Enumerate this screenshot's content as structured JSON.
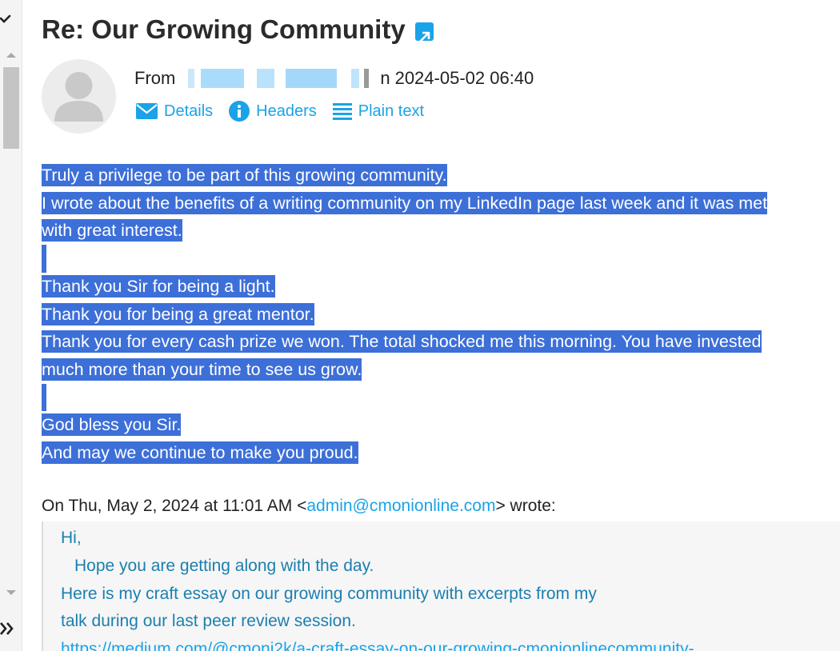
{
  "message": {
    "subject": "Re: Our Growing Community",
    "from_label": "From",
    "date_prefix": "n",
    "date": "2024-05-02 06:40",
    "actions": {
      "details": "Details",
      "headers": "Headers",
      "plain_text": "Plain text"
    },
    "body_lines": [
      "Truly a privilege to be part of this growing community.",
      "I wrote about the benefits of a writing community on my LinkedIn page last week and it was met",
      "with great interest.",
      "",
      "Thank you Sir for being a light.",
      "Thank you for being a great mentor.",
      "Thank you for every cash prize we won. The total shocked me this morning. You have invested",
      "much more than your time to see us grow.",
      "",
      "God bless you Sir.",
      "And may we continue to make you proud."
    ],
    "quote_intro": {
      "prefix": "On Thu, May 2, 2024 at 11:01 AM <",
      "email": "admin@cmonionline.com",
      "suffix": "> wrote:"
    },
    "quote_lines": {
      "greeting": "Hi,",
      "line1": "Hope you are getting along with the day.",
      "line2": "Here is my craft essay on our growing community with excerpts from my",
      "line3": "talk during our last peer review session.",
      "link": "https://medium.com/@cmoni2k/a-craft-essay-on-our-growing-cmonionlinecommunity-"
    }
  },
  "icons": {
    "external_link": "external-link-icon",
    "envelope": "envelope-icon",
    "info": "info-icon",
    "lines": "plain-text-icon",
    "avatar": "default-avatar-icon"
  },
  "colors": {
    "accent": "#1aa3e8",
    "selection": "#3d6fd8",
    "quote_text": "#1a7fb0",
    "quote_bg": "#f6f6f6"
  }
}
